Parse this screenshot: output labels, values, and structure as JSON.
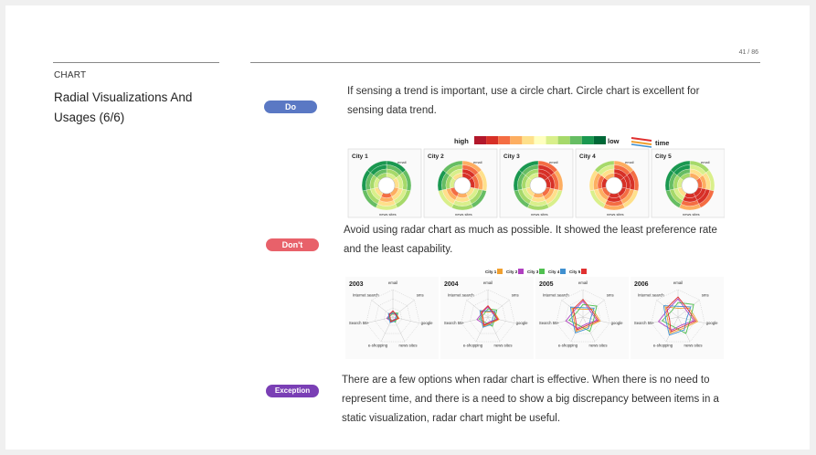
{
  "page": {
    "page_number": "41 / 86",
    "section_label": "CHART",
    "title": "Radial Visualizations And Usages (6/6)"
  },
  "do": {
    "badge": "Do",
    "text": "If sensing a trend is important, use a circle chart.  Circle chart is excellent for sensing data trend.",
    "figure": {
      "legend_high": "high",
      "legend_low": "low",
      "legend_time": "time",
      "scale_colors": [
        "#b2182b",
        "#d73027",
        "#f46d43",
        "#fdae61",
        "#fee08b",
        "#ffffbf",
        "#d9ef8b",
        "#a6d96a",
        "#66bd63",
        "#1a9850",
        "#006837"
      ],
      "cities": [
        {
          "label": "City 1"
        },
        {
          "label": "City 2"
        },
        {
          "label": "City 3"
        },
        {
          "label": "City 4"
        },
        {
          "label": "City 5"
        }
      ],
      "ring_labels": [
        "email",
        "sms",
        "google",
        "news sites",
        "e-shopping",
        "Search 55+",
        "Internet search"
      ]
    }
  },
  "dont": {
    "badge": "Don't",
    "text": "Avoid using radar chart as much as possible. It showed the least preference rate and the least capability.",
    "figure": {
      "legend": [
        {
          "label": "City 1",
          "color": "#f0a030"
        },
        {
          "label": "City 2",
          "color": "#b040c0"
        },
        {
          "label": "City 3",
          "color": "#50c050"
        },
        {
          "label": "City 4",
          "color": "#4090d0"
        },
        {
          "label": "City 5",
          "color": "#e03030"
        }
      ],
      "years": [
        "2003",
        "2004",
        "2005",
        "2006"
      ],
      "axis_labels": {
        "email": "email",
        "sms": "sms",
        "google": "google",
        "news": "news sites",
        "eshop": "e-shopping",
        "search55": "Search 55+",
        "internet": "Internet search"
      }
    }
  },
  "exception": {
    "badge": "Exception",
    "text": "There are a few options when radar chart is effective. When there is no need to represent time, and there is a need to show a big discrepancy between items in a static visualization, radar chart might be useful."
  }
}
